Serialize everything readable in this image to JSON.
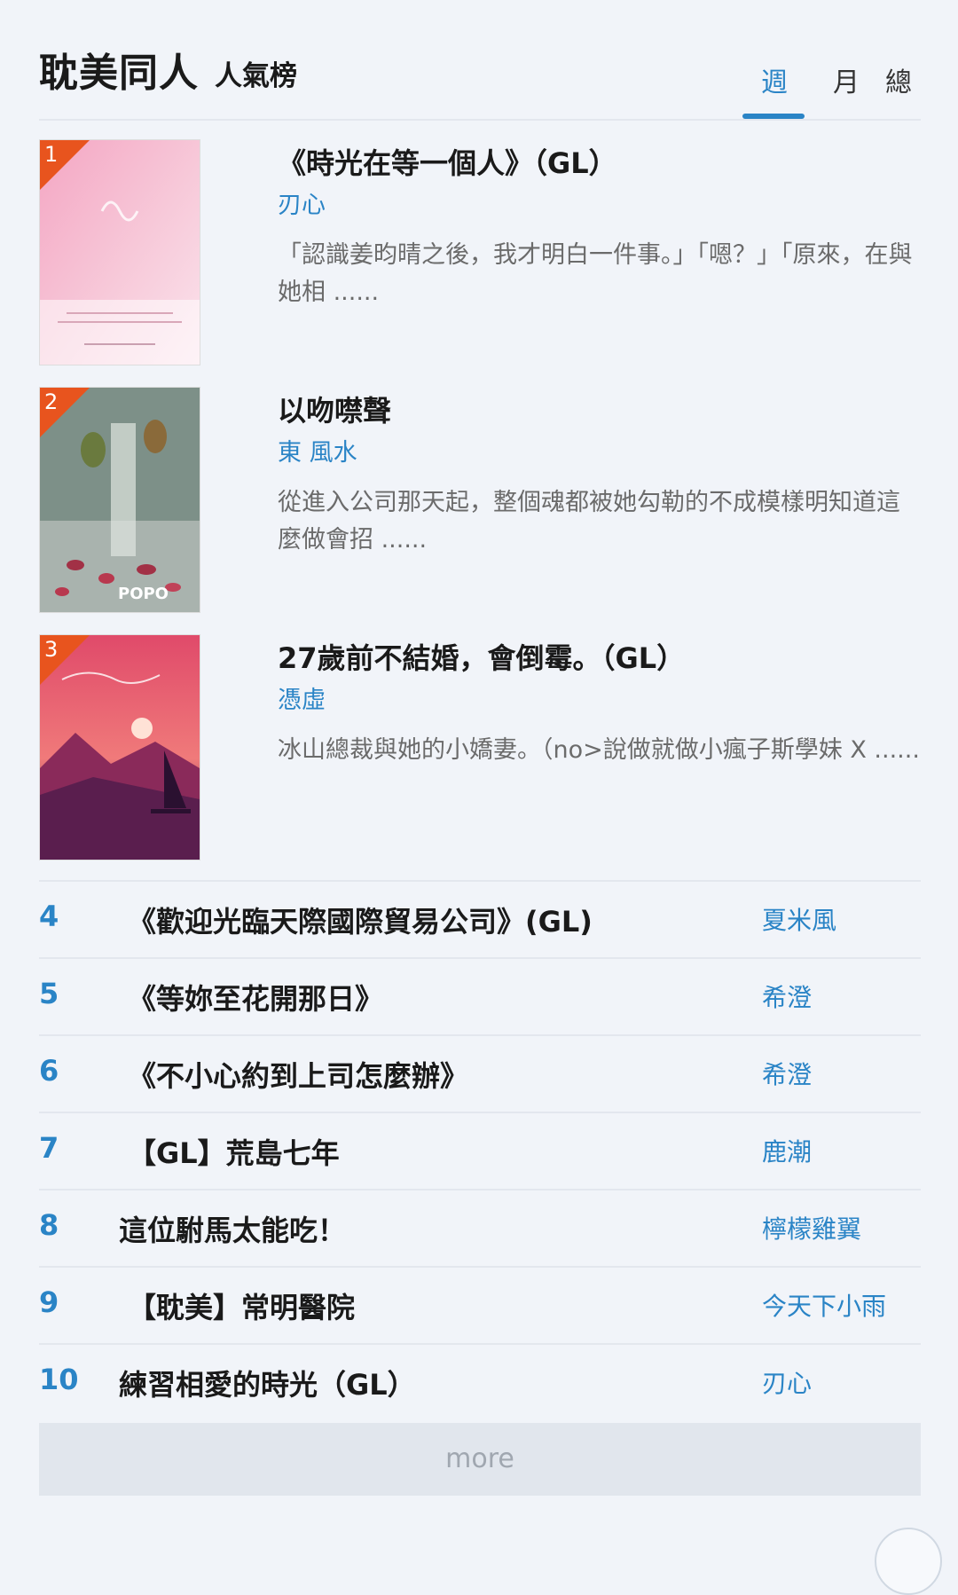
{
  "header": {
    "title": "耽美同人",
    "subtitle": "人氣榜",
    "tabs": [
      "週",
      "月",
      "總"
    ],
    "active_tab": "週"
  },
  "top_items": [
    {
      "rank": "1",
      "title": "《時光在等一個人》（GL）",
      "author": "刃心",
      "description": "「認識姜昀晴之後，我才明白一件事。」「嗯？」「原來，在與她相 ......"
    },
    {
      "rank": "2",
      "title": "以吻噤聲",
      "author": "東 風水",
      "description": "從進入公司那天起，整個魂都被她勾勒的不成模樣明知道這麼做會招 ......"
    },
    {
      "rank": "3",
      "title": "27歲前不結婚，會倒霉。（GL）",
      "author": "憑虛",
      "description": "冰山總裁與她的小嬌妻。（no>說做就做小瘋子斯學妹 X ......"
    }
  ],
  "list_items": [
    {
      "rank": "4",
      "title": "《歡迎光臨天際國際貿易公司》(GL)",
      "author": "夏米風"
    },
    {
      "rank": "5",
      "title": "《等妳至花開那日》",
      "author": "希澄"
    },
    {
      "rank": "6",
      "title": "《不小心約到上司怎麼辦》",
      "author": "希澄"
    },
    {
      "rank": "7",
      "title": "【GL】荒島七年",
      "author": "鹿潮"
    },
    {
      "rank": "8",
      "title": "這位駙馬太能吃！",
      "author": "檸檬雞翼"
    },
    {
      "rank": "9",
      "title": "【耽美】常明醫院",
      "author": "今天下小雨"
    },
    {
      "rank": "10",
      "title": "練習相愛的時光（GL）",
      "author": "刃心"
    }
  ],
  "more_label": "more",
  "colors": {
    "accent": "#2a84c6",
    "rank_tag": "#e8541e",
    "background": "#f1f4f9"
  }
}
